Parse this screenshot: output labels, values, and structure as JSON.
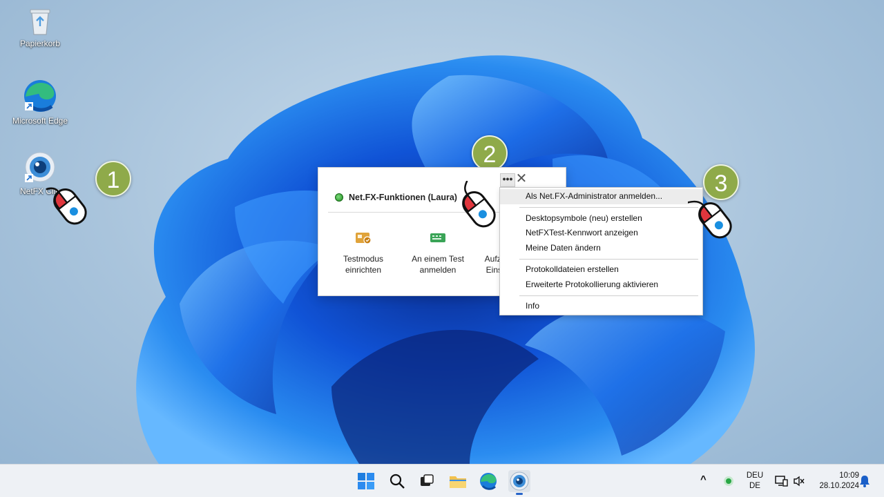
{
  "desktop": {
    "icons": [
      {
        "name": "recycle-bin",
        "label": "Papierkorb"
      },
      {
        "name": "edge",
        "label": "Microsoft Edge"
      },
      {
        "name": "netfx-client",
        "label": "NetFX Clie"
      }
    ]
  },
  "steps": [
    "1",
    "2",
    "3"
  ],
  "panel": {
    "title": "Net.FX-Funktionen (Laura)",
    "more_label": "•••",
    "close_label": "✕",
    "tiles": [
      {
        "line1": "Testmodus",
        "line2": "einrichten",
        "icon": "testmode-icon"
      },
      {
        "line1": "An einem Test",
        "line2": "anmelden",
        "icon": "keyboard-icon"
      },
      {
        "line1": "Aufze",
        "line2": "Einst",
        "icon": "record-icon"
      }
    ]
  },
  "menu": {
    "groups": [
      [
        "Als Net.FX-Administrator anmelden..."
      ],
      [
        "Desktopsymbole (neu) erstellen",
        "NetFXTest-Kennwort anzeigen",
        "Meine Daten ändern"
      ],
      [
        "Protokolldateien erstellen",
        "Erweiterte Protokollierung aktivieren"
      ],
      [
        "Info"
      ]
    ],
    "highlighted": "Als Net.FX-Administrator anmelden..."
  },
  "taskbar": {
    "apps": [
      "start-icon",
      "search-icon",
      "task-view-icon",
      "file-explorer-icon",
      "edge-icon",
      "netfx-icon"
    ],
    "tray": {
      "chevron": "^",
      "lang_top": "DEU",
      "lang_bottom": "DE",
      "time": "10:09",
      "date": "28.10.2024"
    }
  },
  "colors": {
    "accent": "#2563c9",
    "badge": "#8faa4a",
    "mouse_red": "#e0363d",
    "mouse_blue": "#1a8fe0"
  }
}
